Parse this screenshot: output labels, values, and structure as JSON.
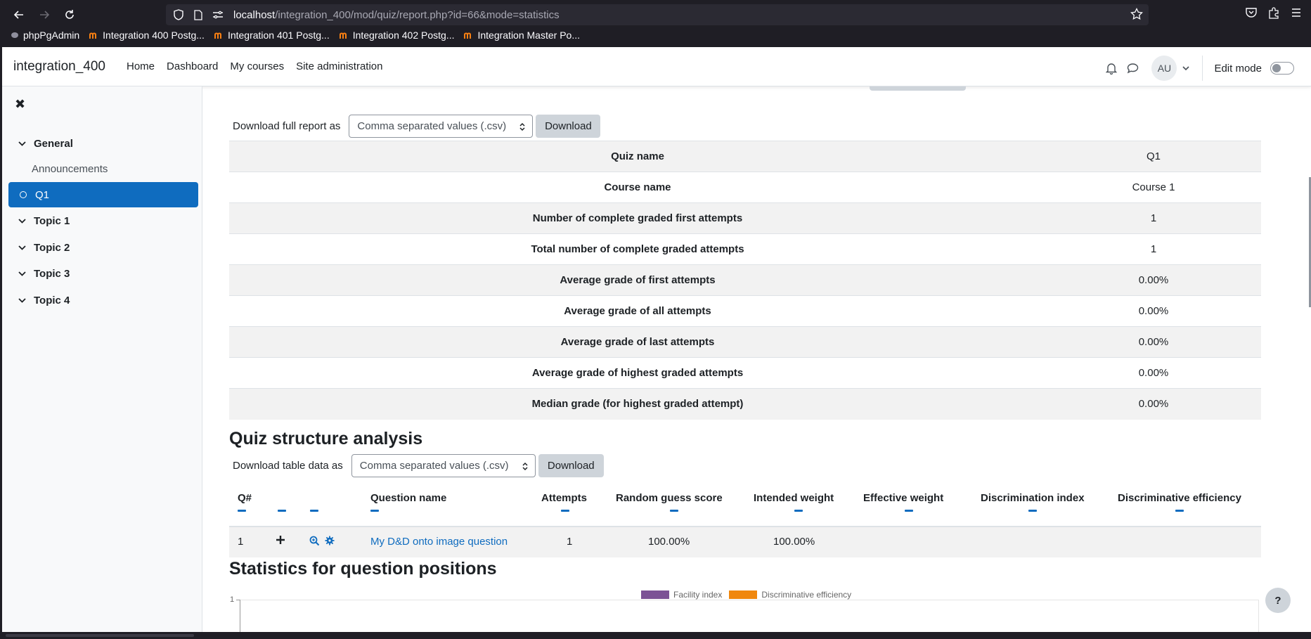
{
  "browser": {
    "url_host": "localhost",
    "url_path": "/integration_400/mod/quiz/report.php?id=66&mode=statistics",
    "bookmarks": [
      {
        "label": "phpPgAdmin"
      },
      {
        "label": "Integration 400 Postg..."
      },
      {
        "label": "Integration 401 Postg..."
      },
      {
        "label": "Integration 402 Postg..."
      },
      {
        "label": "Integration Master Po..."
      }
    ]
  },
  "navbar": {
    "site_name": "integration_400",
    "links": [
      "Home",
      "Dashboard",
      "My courses",
      "Site administration"
    ],
    "avatar_initials": "AU",
    "edit_mode_label": "Edit mode"
  },
  "drawer": {
    "close_glyph": "✖",
    "items": [
      {
        "label": "General",
        "kind": "section"
      },
      {
        "label": "Announcements",
        "kind": "plain"
      },
      {
        "label": "Q1",
        "kind": "active"
      },
      {
        "label": "Topic 1",
        "kind": "section"
      },
      {
        "label": "Topic 2",
        "kind": "section"
      },
      {
        "label": "Topic 3",
        "kind": "section"
      },
      {
        "label": "Topic 4",
        "kind": "section"
      }
    ]
  },
  "report": {
    "download_full_label": "Download full report as",
    "format_selected": "Comma separated values (.csv)",
    "download_button": "Download",
    "stats": [
      {
        "key": "Quiz name",
        "value": "Q1"
      },
      {
        "key": "Course name",
        "value": "Course 1"
      },
      {
        "key": "Number of complete graded first attempts",
        "value": "1"
      },
      {
        "key": "Total number of complete graded attempts",
        "value": "1"
      },
      {
        "key": "Average grade of first attempts",
        "value": "0.00%"
      },
      {
        "key": "Average grade of all attempts",
        "value": "0.00%"
      },
      {
        "key": "Average grade of last attempts",
        "value": "0.00%"
      },
      {
        "key": "Average grade of highest graded attempts",
        "value": "0.00%"
      },
      {
        "key": "Median grade (for highest graded attempt)",
        "value": "0.00%"
      }
    ]
  },
  "structure": {
    "title": "Quiz structure analysis",
    "download_table_label": "Download table data as",
    "format_selected": "Comma separated values (.csv)",
    "download_button": "Download",
    "headers": {
      "qnum": "Q#",
      "name": "Question name",
      "attempts": "Attempts",
      "random": "Random guess score",
      "intended": "Intended weight",
      "effective": "Effective weight",
      "discrimination": "Discrimination index",
      "efficiency": "Discriminative efficiency"
    },
    "row": {
      "qnum": "1",
      "name": "My D&D onto image question",
      "attempts": "1",
      "random": "100.00%",
      "intended": "100.00%",
      "effective": "",
      "discrimination": "",
      "efficiency": ""
    }
  },
  "positions": {
    "title": "Statistics for question positions",
    "legend": [
      {
        "label": "Facility index",
        "color": "#7c5295"
      },
      {
        "label": "Discriminative efficiency",
        "color": "#f0870d"
      }
    ],
    "y_tick_top": "1"
  },
  "help_glyph": "?"
}
